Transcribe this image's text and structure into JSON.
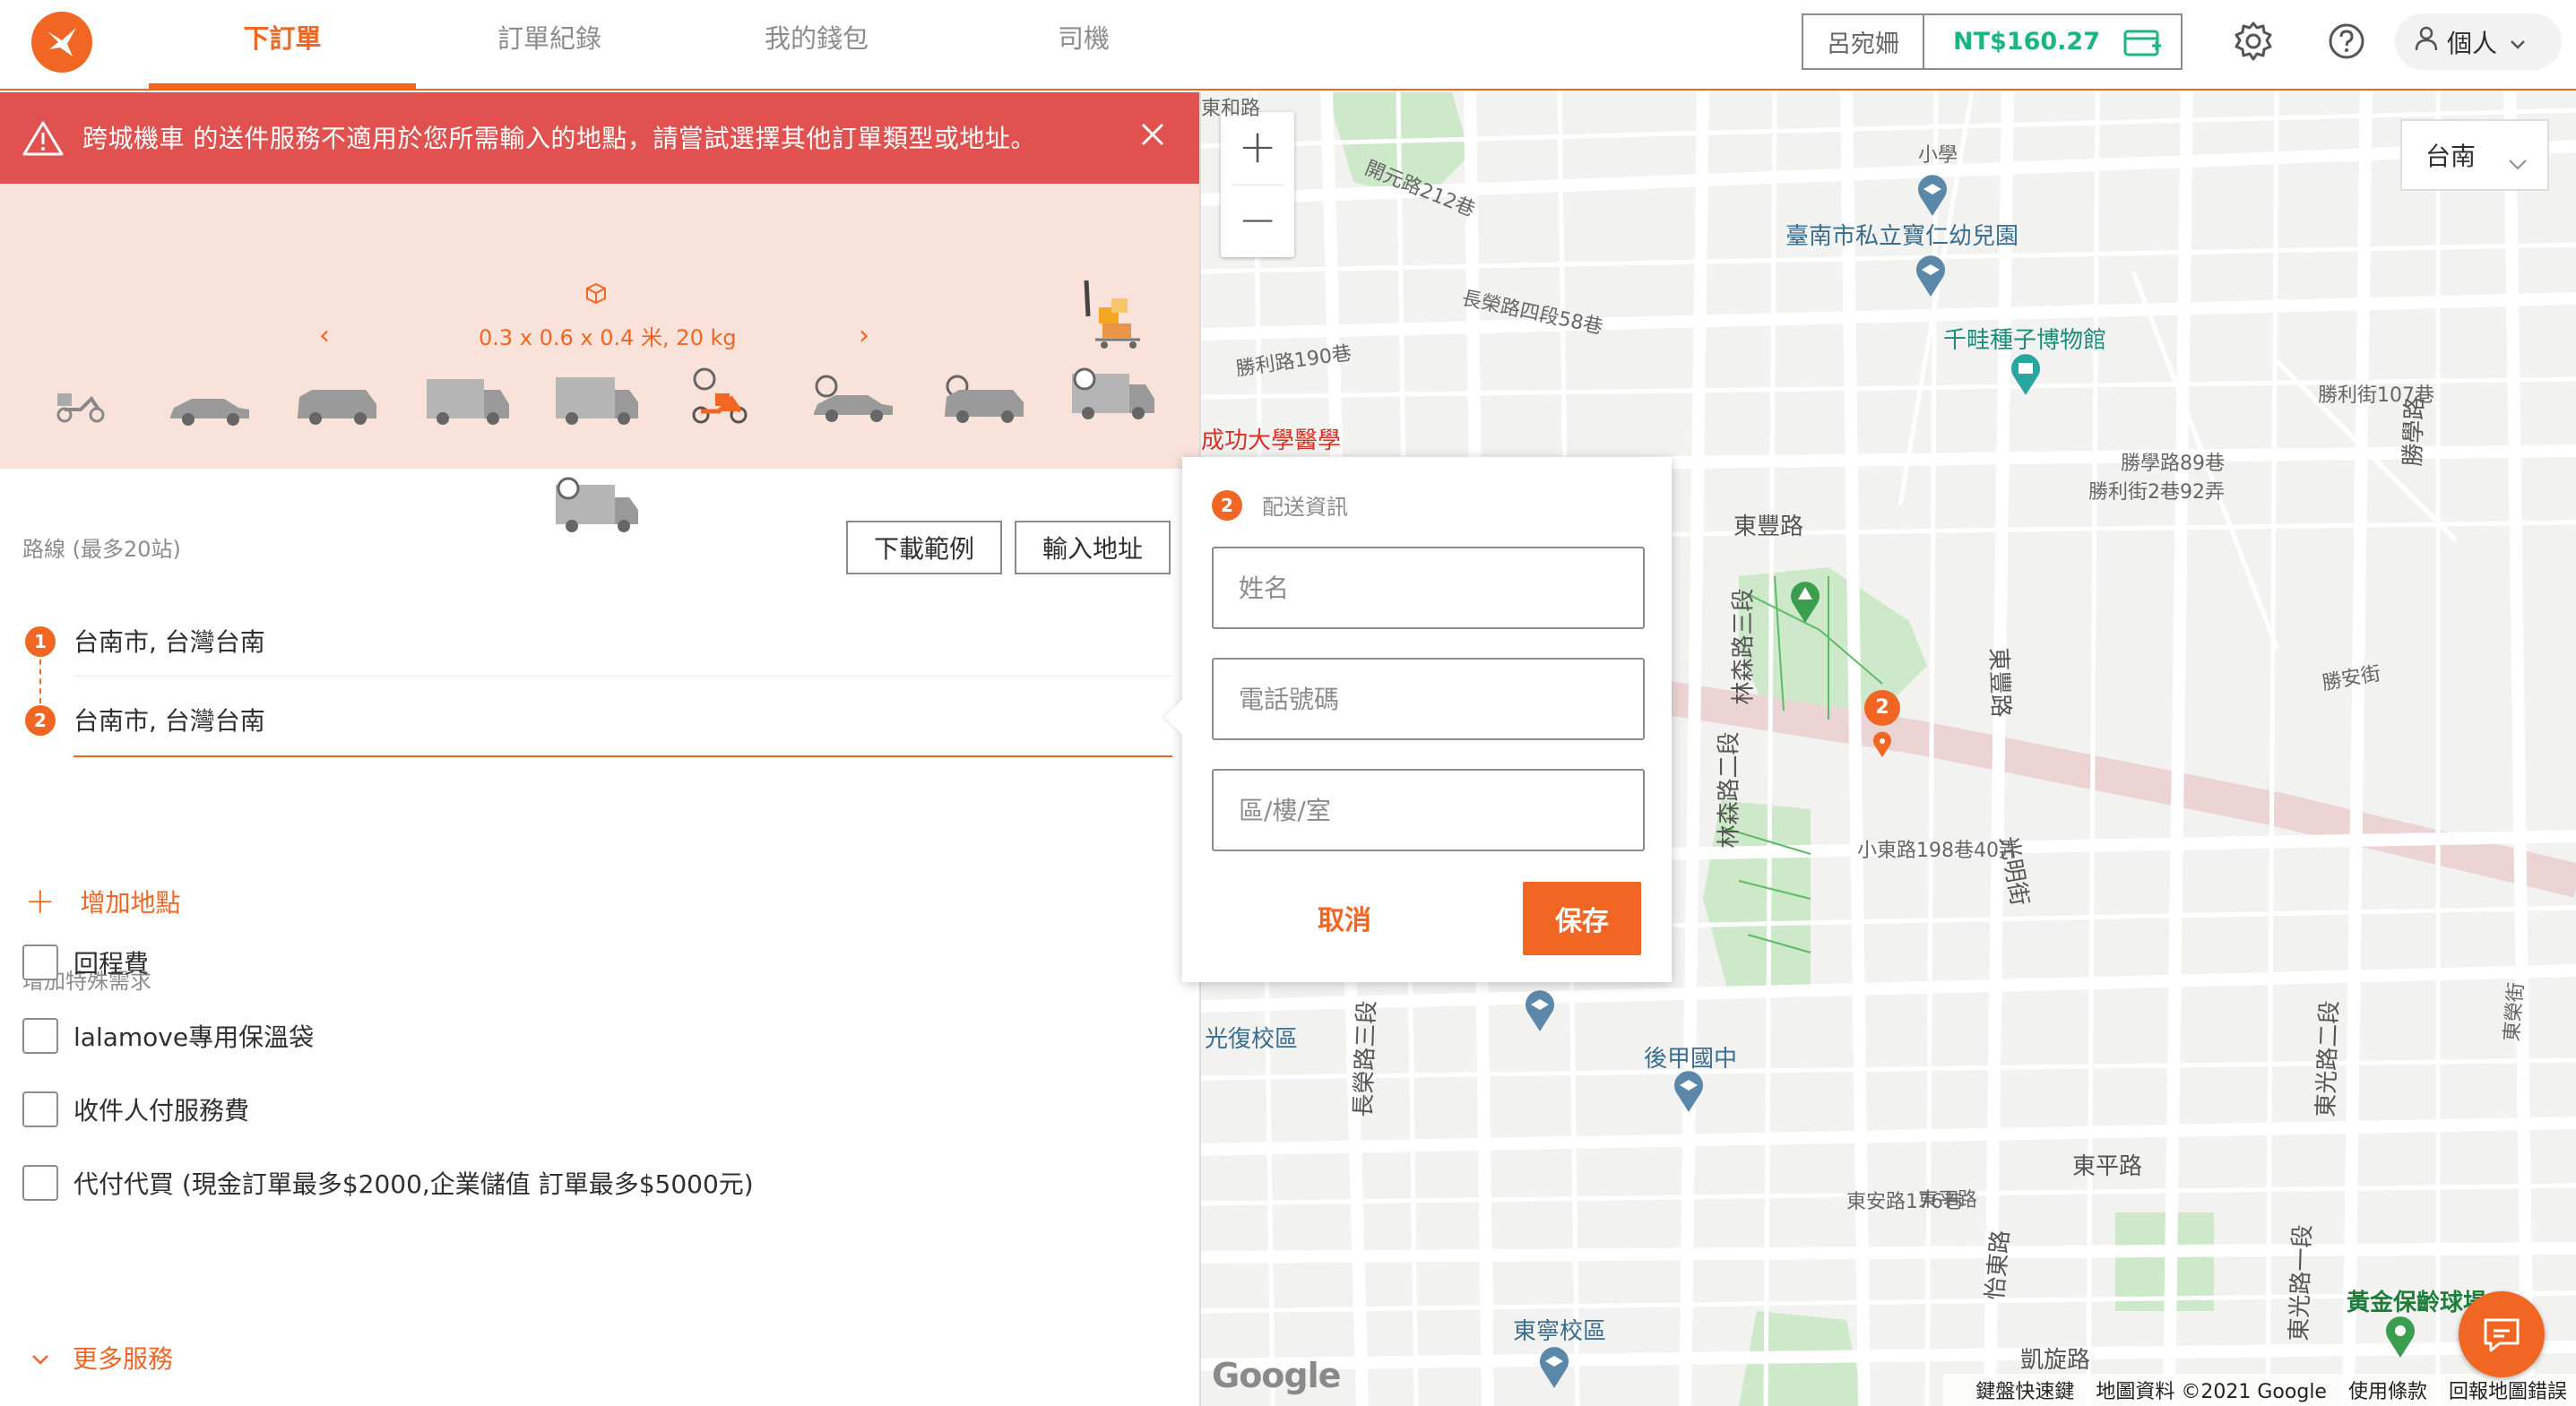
{
  "header": {
    "tabs": [
      {
        "label": "下訂單",
        "active": true
      },
      {
        "label": "訂單紀錄",
        "active": false
      },
      {
        "label": "我的錢包",
        "active": false
      },
      {
        "label": "司機",
        "active": false
      }
    ],
    "wallet": {
      "user": "呂宛姍",
      "balance": "NT$160.27"
    },
    "account_label": "個人",
    "icons": {
      "logo": "lalamove-bird-icon",
      "settings": "gear-icon",
      "help": "question-circle-icon",
      "account": "person-icon",
      "wallet_add": "wallet-add-icon"
    }
  },
  "banner": {
    "message": "跨城機車 的送件服務不適用於您所需輸入的地點，請嘗試選擇其他訂單類型或地址。",
    "color": "#e0514f"
  },
  "vehicles": {
    "dimensions": "0.3 x 0.6 x 0.4 米, 20 kg",
    "prev_arrow": "‹",
    "next_arrow": "›"
  },
  "route": {
    "label": "路線 (最多20站)",
    "download_button": "下載範例",
    "import_button": "輸入地址",
    "stops": [
      {
        "number": "1",
        "address": "台南市, 台灣台南"
      },
      {
        "number": "2",
        "address": "台南市, 台灣台南"
      }
    ],
    "add_stop": "增加地點"
  },
  "special": {
    "label": "增加特殊需求",
    "options": [
      {
        "label": "回程費"
      },
      {
        "label": "lalamove專用保溫袋"
      },
      {
        "label": "收件人付服務費"
      },
      {
        "label": "代付代買 (現金訂單最多$2000,企業儲值 訂單最多$5000元)"
      }
    ],
    "more": "更多服務"
  },
  "popup": {
    "step": "2",
    "title": "配送資訊",
    "name_placeholder": "姓名",
    "phone_placeholder": "電話號碼",
    "unit_placeholder": "區/樓/室",
    "cancel": "取消",
    "save": "保存"
  },
  "map": {
    "city": "台南",
    "zoom_in": "+",
    "zoom_out": "−",
    "pin_number": "2",
    "brand": "Google",
    "footer": [
      "鍵盤快速鍵",
      "地圖資料 ©2021 Google",
      "使用條款",
      "回報地圖錯誤"
    ],
    "labels": {
      "kindergarten": "臺南市私立寶仁幼兒園",
      "museum": "千畦種子博物館",
      "hospital": "成功大學醫學",
      "school1": "小學",
      "school2": "後甲國中",
      "school3": "東寧校區",
      "school4": "光復校區",
      "bowling": "黃金保齡球場",
      "road_dongfeng": "東豐路",
      "road_dongfeng2": "東豐路",
      "road_linsen3": "林森路三段",
      "road_linsen2": "林森路二段",
      "road_guangming": "光明街",
      "road_dongping": "東平路",
      "road_yidong": "怡東路",
      "road_kaixuan": "凱旋路",
      "road_changrong": "長榮路三段",
      "road_dongguang": "東光路一段",
      "road_dongguang2": "東光路二段",
      "road_shengxue": "勝學路",
      "road_shengli": "勝利路190巷",
      "road_shengan": "勝安街",
      "road_donghe": "東和路",
      "road_xiaodong": "小東路198巷40弄",
      "road_dongan": "東安路176巷",
      "road_changrong4": "長榮路四段58巷",
      "road_shenglixue": "勝學路89巷",
      "road_shengli2": "勝利街2巷92弄",
      "road_shengli107": "勝利街107巷",
      "road_pinghe": "東平路",
      "road_dongrong": "東榮街",
      "road_kaiyuan": "開元路212巷"
    }
  }
}
